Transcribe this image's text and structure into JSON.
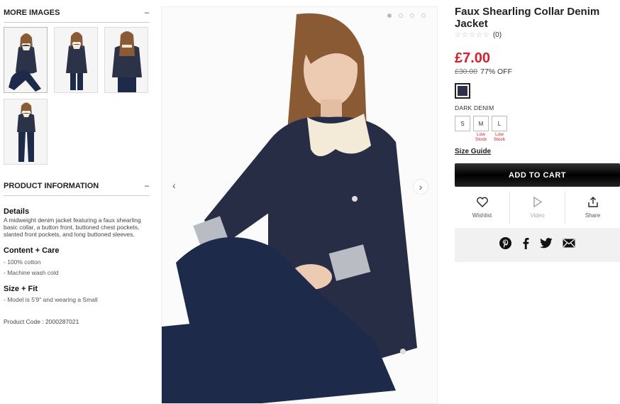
{
  "more_images": {
    "title": "MORE IMAGES",
    "toggle": "–"
  },
  "product_info": {
    "title": "PRODUCT INFORMATION",
    "toggle": "–"
  },
  "details": {
    "heading": "Details",
    "text": "A midweight denim jacket featuring a faux shearling basic collar, a button front, buttoned chest pockets, slanted front pockets, and long buttoned sleeves."
  },
  "content_care": {
    "heading": "Content + Care",
    "items": [
      "- 100% cotton",
      "- Machine wash cold"
    ]
  },
  "size_fit": {
    "heading": "Size + Fit",
    "items": [
      "- Model is 5'9\" and wearing a Small"
    ]
  },
  "product_code": "Product Code : 2000287021",
  "product": {
    "title": "Faux Shearling Collar Denim Jacket",
    "stars": "☆☆☆☆☆",
    "review_count": "(0)",
    "price": "£7.00",
    "was_price": "£30.00",
    "discount": "77% OFF",
    "color_name": "DARK DENIM",
    "color_hex": "#2c3247",
    "sizes": [
      {
        "label": "S",
        "note": ""
      },
      {
        "label": "M",
        "note": "Low Stock"
      },
      {
        "label": "L",
        "note": "Low Stock"
      }
    ],
    "size_guide": "Size Guide",
    "add_to_cart": "ADD TO CART"
  },
  "actions": {
    "wishlist": "Wishlist",
    "video": "Video",
    "share": "Share"
  },
  "colors": {
    "price_red": "#d3212d"
  }
}
